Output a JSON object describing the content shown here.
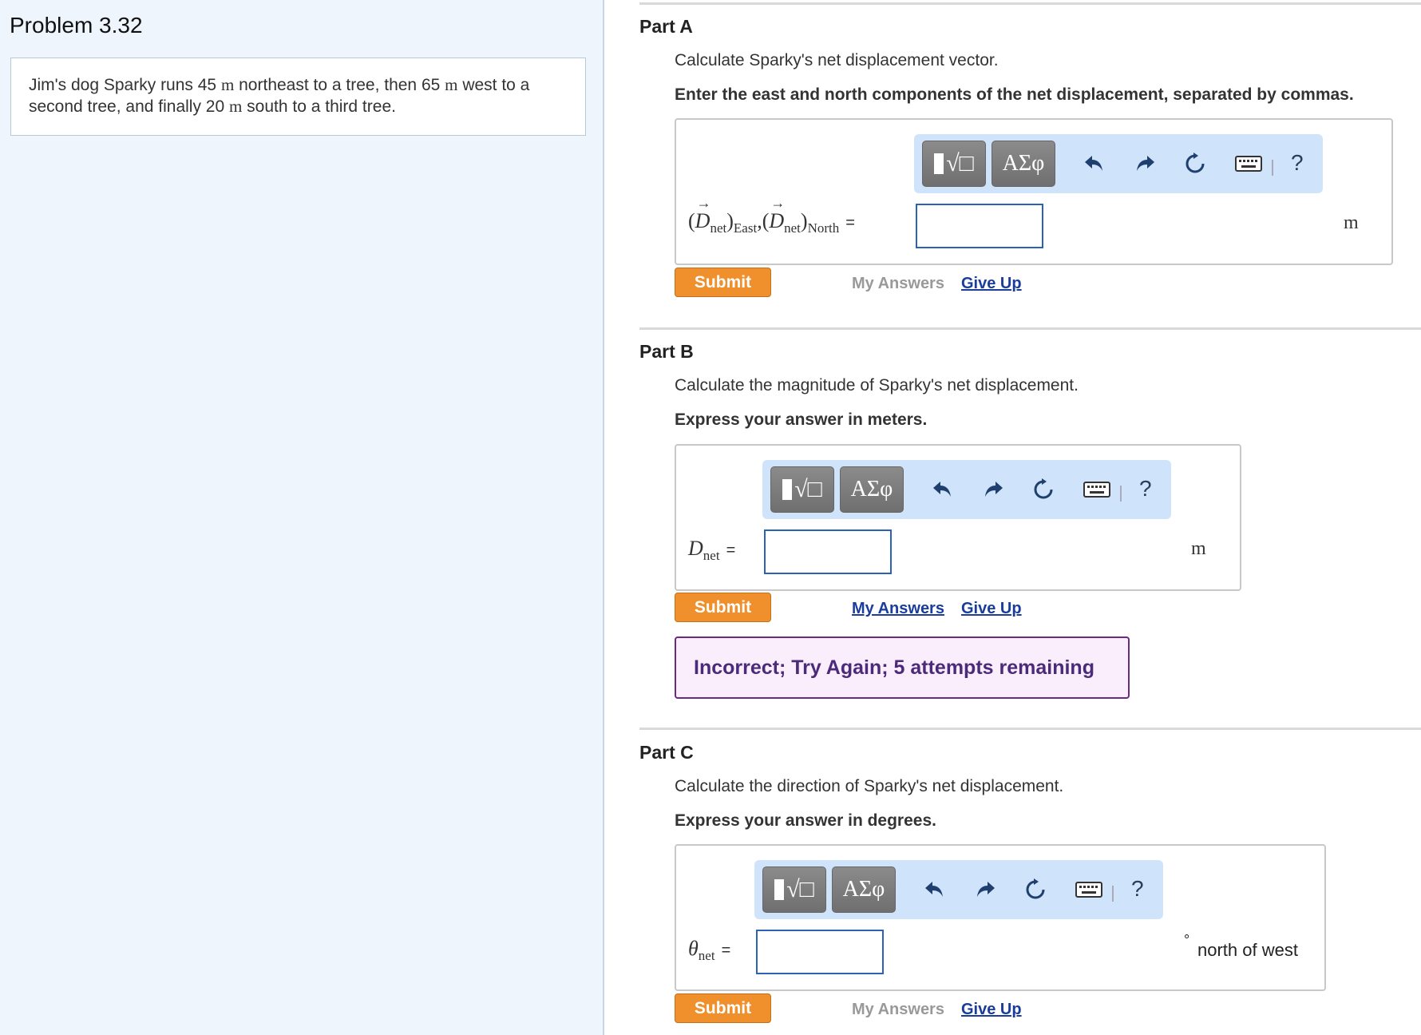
{
  "problem": {
    "title": "Problem 3.32",
    "text_1": "Jim's dog Sparky runs 45 ",
    "unit_1": "m",
    "text_2": " northeast to a tree, then 65 ",
    "unit_2": "m",
    "text_3": " west to a second tree, and finally 20 ",
    "unit_3": "m",
    "text_4": " south to a third tree."
  },
  "toolbar": {
    "template_icon": "sqrt-template-icon",
    "greek_label": "ΑΣφ",
    "undo_icon": "undo-icon",
    "redo_icon": "redo-icon",
    "reset_icon": "reset-icon",
    "keyboard_icon": "keyboard-icon",
    "help_label": "?"
  },
  "partA": {
    "title": "Part A",
    "question": "Calculate Sparky's net displacement vector.",
    "instruction": "Enter the east and north components of the net displacement, separated by commas.",
    "label_D": "D",
    "label_net": "net",
    "label_east": "East",
    "label_north": "North",
    "label_eq": "=",
    "input_value": "",
    "unit": "m",
    "submit": "Submit",
    "my_answers": "My Answers",
    "give_up": "Give Up"
  },
  "partB": {
    "title": "Part B",
    "question": "Calculate the magnitude of Sparky's net displacement.",
    "instruction": "Express your answer in meters.",
    "label_D": "D",
    "label_net": "net",
    "label_eq": "=",
    "input_value": "",
    "unit": "m",
    "submit": "Submit",
    "my_answers": "My Answers",
    "give_up": "Give Up",
    "feedback": "Incorrect; Try Again; 5 attempts remaining"
  },
  "partC": {
    "title": "Part C",
    "question": "Calculate the direction of Sparky's net displacement.",
    "instruction": "Express your answer in degrees.",
    "label_theta": "θ",
    "label_net": "net",
    "label_eq": "=",
    "input_value": "",
    "degree_symbol": "°",
    "unit": "north of west",
    "submit": "Submit",
    "my_answers": "My Answers",
    "give_up": "Give Up"
  },
  "colors": {
    "submit": "#f0902c",
    "link": "#1a3d9c",
    "feedback_border": "#6b2a7b",
    "toolbar_bg": "#cfe4fb"
  }
}
